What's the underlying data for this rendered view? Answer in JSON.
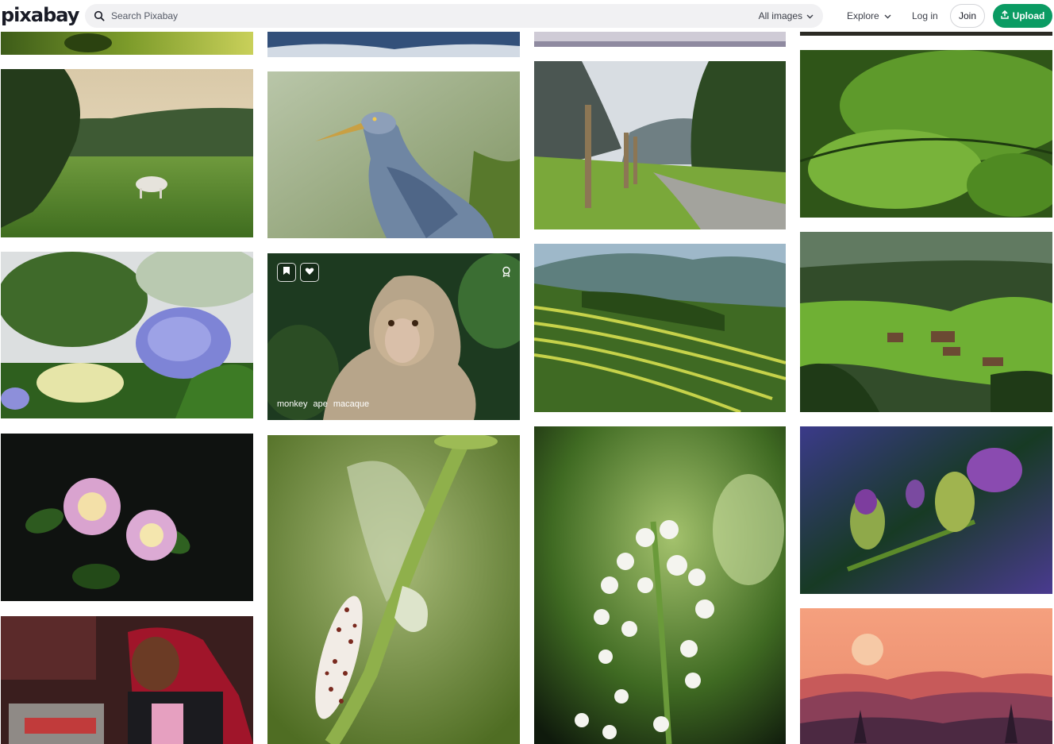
{
  "brand": {
    "logo_text": "pixabay",
    "accent_color": "#0a9b63"
  },
  "search": {
    "placeholder": "Search Pixabay",
    "filter_label": "All images"
  },
  "nav": {
    "explore_label": "Explore",
    "login_label": "Log in",
    "join_label": "Join",
    "upload_label": "Upload"
  },
  "icons": {
    "search": "search-icon",
    "chevron": "chevron-down-icon",
    "upload": "upload-icon",
    "bookmark": "bookmark-icon",
    "like": "heart-icon",
    "award": "award-icon"
  },
  "hovered_image": {
    "tags": [
      "monkey",
      "ape",
      "macaque"
    ]
  },
  "gallery": {
    "images": [
      {
        "subject": "green-foliage"
      },
      {
        "subject": "mountain-clouds"
      },
      {
        "subject": "frost-grass"
      },
      {
        "subject": "dark-edge"
      },
      {
        "subject": "cow-in-meadow"
      },
      {
        "subject": "grey-heron"
      },
      {
        "subject": "mountain-path-fence"
      },
      {
        "subject": "maple-leaves"
      },
      {
        "subject": "hydrangea-flowers"
      },
      {
        "subject": "macaque-monkey"
      },
      {
        "subject": "rice-terraces"
      },
      {
        "subject": "alpine-village"
      },
      {
        "subject": "lantana-flowers"
      },
      {
        "subject": "moth-on-stem"
      },
      {
        "subject": "white-alyssum"
      },
      {
        "subject": "purple-buds"
      },
      {
        "subject": "woman-workshop"
      },
      {
        "subject": "sunset-mountains"
      }
    ]
  }
}
